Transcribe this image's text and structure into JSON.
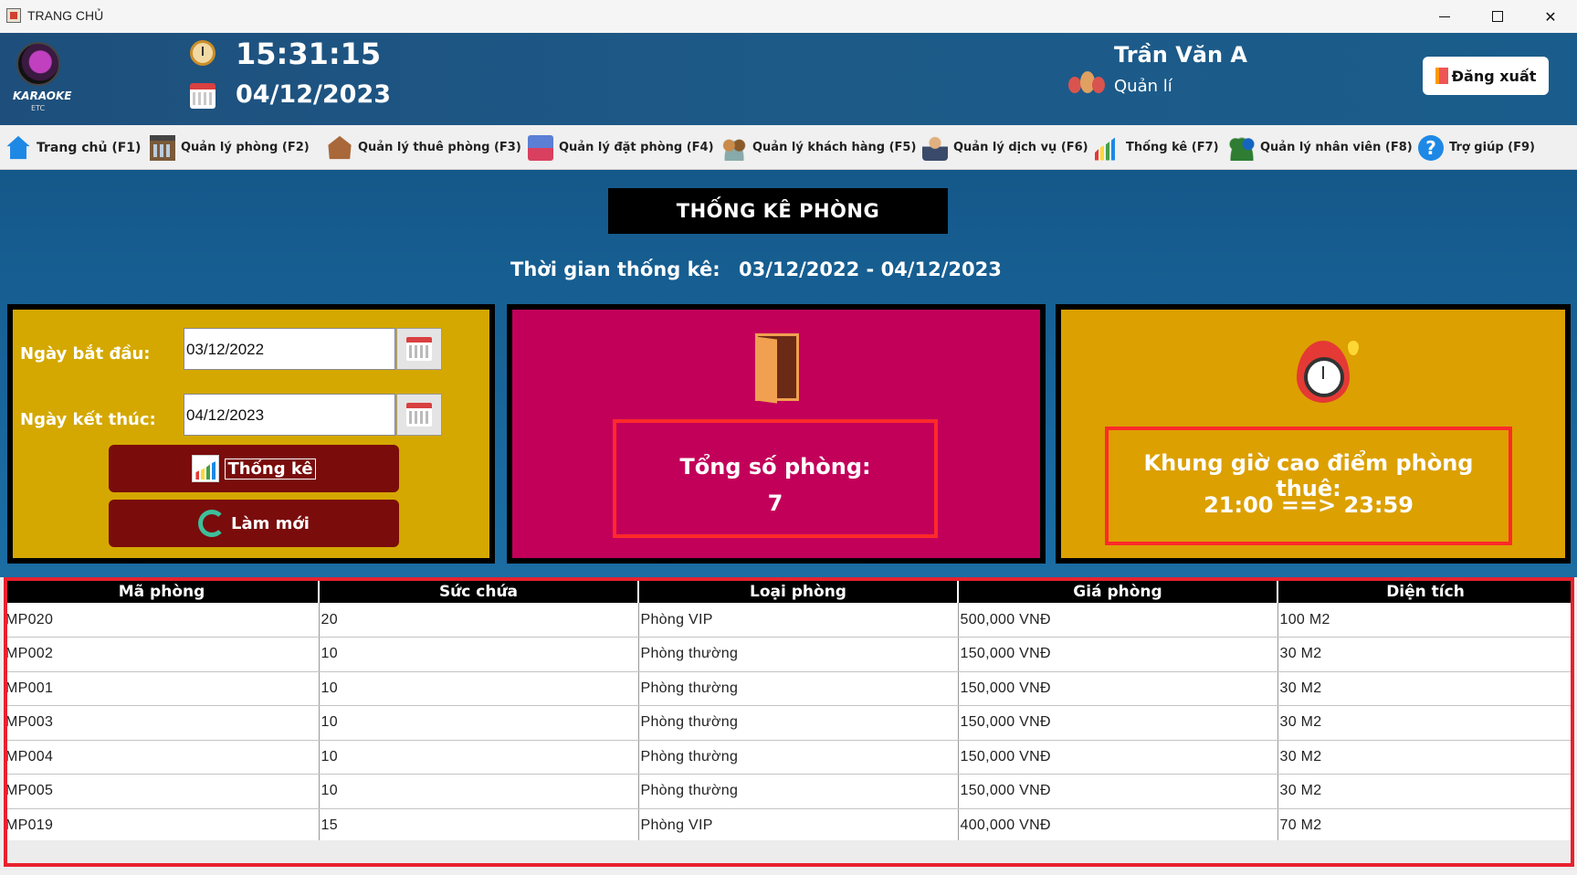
{
  "window": {
    "title": "TRANG CHỦ"
  },
  "header": {
    "logo_text": "KARAOKE",
    "logo_sub": "ETC",
    "time": "15:31:15",
    "date": "04/12/2023",
    "user_name": "Trần Văn A",
    "user_role": "Quản lí",
    "logout_label": "Đăng xuất"
  },
  "menu": [
    {
      "label": "Trang chủ (F1)",
      "icon": "home-icon"
    },
    {
      "label": "Quản lý phòng (F2)",
      "icon": "building-icon"
    },
    {
      "label": "Quản lý thuê phòng (F3)",
      "icon": "rent-house-icon"
    },
    {
      "label": "Quản lý đặt phòng (F4)",
      "icon": "booking-icon"
    },
    {
      "label": "Quản lý khách hàng (F5)",
      "icon": "customers-icon"
    },
    {
      "label": "Quản lý dịch vụ (F6)",
      "icon": "service-icon"
    },
    {
      "label": "Thống kê (F7)",
      "icon": "stats-chart-icon"
    },
    {
      "label": "Quản lý nhân viên (F8)",
      "icon": "staff-icon"
    },
    {
      "label": "Trợ giúp (F9)",
      "icon": "help-icon"
    }
  ],
  "stats": {
    "title": "THỐNG KÊ PHÒNG",
    "period_label": "Thời gian thống kê:",
    "period_value": "03/12/2022 - 04/12/2023",
    "filter": {
      "start_label": "Ngày bắt đầu:",
      "start_value": "03/12/2022",
      "end_label": "Ngày kết thúc:",
      "end_value": "04/12/2023",
      "stats_button": "Thống kê",
      "refresh_button": "Làm mới"
    },
    "rooms_label": "Tổng số phòng:",
    "rooms_value": "7",
    "peak_label": "Khung giờ cao điểm phòng thuê:",
    "peak_value": "21:00 ==> 23:59"
  },
  "colors": {
    "filter_panel": "#d4a800",
    "rooms_panel": "#c2005a",
    "peak_panel": "#dca000",
    "button": "#7a0c0c",
    "highlight": "#e8212e"
  },
  "table": {
    "columns": [
      "Mã phòng",
      "Sức chứa",
      "Loại phòng",
      "Giá phòng",
      "Diện tích"
    ],
    "rows": [
      [
        "MP020",
        "20",
        "Phòng VIP",
        "500,000 VNĐ",
        "100 M2"
      ],
      [
        "MP002",
        "10",
        "Phòng thường",
        "150,000 VNĐ",
        "30 M2"
      ],
      [
        "MP001",
        "10",
        "Phòng thường",
        "150,000 VNĐ",
        "30 M2"
      ],
      [
        "MP003",
        "10",
        "Phòng thường",
        "150,000 VNĐ",
        "30 M2"
      ],
      [
        "MP004",
        "10",
        "Phòng thường",
        "150,000 VNĐ",
        "30 M2"
      ],
      [
        "MP005",
        "10",
        "Phòng thường",
        "150,000 VNĐ",
        "30 M2"
      ],
      [
        "MP019",
        "15",
        "Phòng VIP",
        "400,000 VNĐ",
        "70 M2"
      ]
    ]
  }
}
